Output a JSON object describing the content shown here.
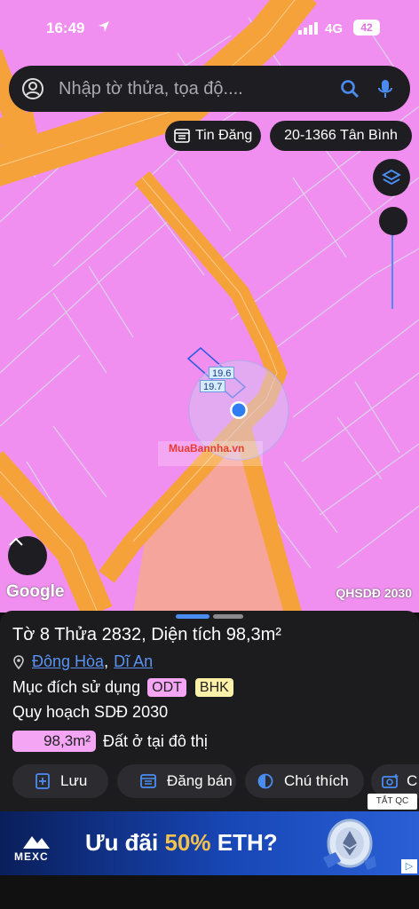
{
  "status_bar": {
    "time": "16:49",
    "network": "4G",
    "battery": "42"
  },
  "search": {
    "placeholder": "Nhập tờ thửa, tọa độ...."
  },
  "chips": {
    "listing": "Tin Đăng",
    "address": "20-1366 Tân Bình"
  },
  "map": {
    "dimension_labels": [
      "19.6",
      "19.7"
    ],
    "watermark": "MuaBannha.vn",
    "attribution": "Google",
    "layer_name": "QHSDĐ 2030",
    "colors": {
      "residential": "#f08ff0",
      "road": "#f6a23a",
      "public_land": "#f5a59c",
      "parcel_lines": "#d9dde8",
      "marker": "#2f7df0"
    }
  },
  "parcel": {
    "title": "Tờ 8 Thửa 2832, Diện tích 98,3m²",
    "ward": "Đông Hòa",
    "city": "Dĩ An",
    "purpose_label": "Mục đích sử dụng",
    "purpose_codes": [
      "ODT",
      "BHK"
    ],
    "plan_label": "Quy hoạch SDĐ 2030",
    "plan_area": "98,3m²",
    "plan_area_desc": "Đất ở tại đô thị"
  },
  "actions": [
    {
      "label": "Lưu",
      "icon": "add-bookmark-icon"
    },
    {
      "label": "Đăng bán",
      "icon": "listing-icon"
    },
    {
      "label": "Chú thích",
      "icon": "contrast-icon"
    },
    {
      "label": "C",
      "icon": "camera-icon"
    }
  ],
  "ad": {
    "close_label": "TẮT QC",
    "brand": "MEXC",
    "headline_prefix": "Ưu đãi ",
    "headline_highlight": "50%",
    "headline_suffix": " ETH?",
    "info_icon": "ad-choices-icon"
  }
}
